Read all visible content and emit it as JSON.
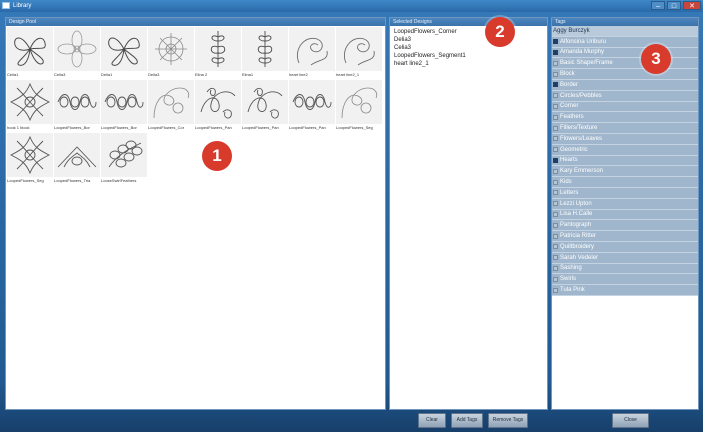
{
  "window": {
    "title": "Library",
    "buttons": {
      "minimize": "–",
      "maximize": "□",
      "close": "✕"
    }
  },
  "design_pool": {
    "header": "Design Pool",
    "items": [
      {
        "caption": "Celia1",
        "icon": "lily-quilt-design"
      },
      {
        "caption": "Celia3",
        "icon": "petal-quilt-design"
      },
      {
        "caption": "Delia1",
        "icon": "lily-quilt-design"
      },
      {
        "caption": "Delia3",
        "icon": "flower-quilt-design"
      },
      {
        "caption": "Elina 2",
        "icon": "vine-border-quilt-design"
      },
      {
        "caption": "Elina1",
        "icon": "vine-border-quilt-design"
      },
      {
        "caption": "heart line2",
        "icon": "swirl-quilt-design"
      },
      {
        "caption": "heart line2_1",
        "icon": "swirl-quilt-design"
      },
      {
        "caption": "hook 1 block",
        "icon": "star-flower-quilt-design"
      },
      {
        "caption": "LoopedFlowers_Bor",
        "icon": "looped-border-quilt-design"
      },
      {
        "caption": "LoopedFlowers_Bor",
        "icon": "looped-border-quilt-design"
      },
      {
        "caption": "LoopedFlowers_Cor",
        "icon": "looped-corner-quilt-design"
      },
      {
        "caption": "LoopedFlowers_Pan",
        "icon": "looped-panto-quilt-design"
      },
      {
        "caption": "LoopedFlowers_Pan",
        "icon": "looped-panto-quilt-design"
      },
      {
        "caption": "LoopedFlowers_Pan",
        "icon": "looped-border-quilt-design"
      },
      {
        "caption": "LoopedFlowers_Seg",
        "icon": "looped-corner-quilt-design"
      },
      {
        "caption": "LoopedFlowers_Seg",
        "icon": "star-flower-quilt-design"
      },
      {
        "caption": "LoopedFlowers_Tria",
        "icon": "triangle-quilt-design"
      },
      {
        "caption": "LooseSwirlFeathers",
        "icon": "feather-quilt-design"
      }
    ]
  },
  "selected_designs": {
    "header": "Selected Designs",
    "items": [
      "LoopedFlowers_Corner",
      "Delia3",
      "Celia3",
      "LoopedFlowers_Segment1",
      "heart line2_1"
    ]
  },
  "tags": {
    "header": "Tags",
    "items": [
      {
        "label": "Aggy Burczyk",
        "checked": false
      },
      {
        "label": "Alfonsina Uriburu",
        "checked": true
      },
      {
        "label": "Amanda Murphy",
        "checked": true
      },
      {
        "label": "Basic Shape/Frame",
        "checked": false
      },
      {
        "label": "Block",
        "checked": false
      },
      {
        "label": "Border",
        "checked": true
      },
      {
        "label": "Circles/Pebbles",
        "checked": false
      },
      {
        "label": "Corner",
        "checked": false
      },
      {
        "label": "Feathers",
        "checked": false
      },
      {
        "label": "Fillers/Texture",
        "checked": false
      },
      {
        "label": "Flowers/Leaves",
        "checked": false
      },
      {
        "label": "Geometric",
        "checked": false
      },
      {
        "label": "Hearts",
        "checked": true
      },
      {
        "label": "Kary Emmerson",
        "checked": false
      },
      {
        "label": "Kids",
        "checked": false
      },
      {
        "label": "Letters",
        "checked": false
      },
      {
        "label": "Lezzi Upton",
        "checked": false
      },
      {
        "label": "Lisa H.Calle",
        "checked": false
      },
      {
        "label": "Pantograph",
        "checked": false
      },
      {
        "label": "Patricia Ritter",
        "checked": false
      },
      {
        "label": "Quiltbroidery",
        "checked": false
      },
      {
        "label": "Sarah Vedeler",
        "checked": false
      },
      {
        "label": "Sashing",
        "checked": false
      },
      {
        "label": "Swirls",
        "checked": false
      },
      {
        "label": "Tula Pink",
        "checked": false
      }
    ]
  },
  "buttons": {
    "clear": "Clear",
    "add_tags": "Add Tags",
    "remove_tags": "Remove Tags",
    "close": "Close"
  },
  "callouts": [
    "1",
    "2",
    "3"
  ],
  "colors": {
    "accent": "#2a6aa8",
    "badge": "#d83a2c"
  }
}
